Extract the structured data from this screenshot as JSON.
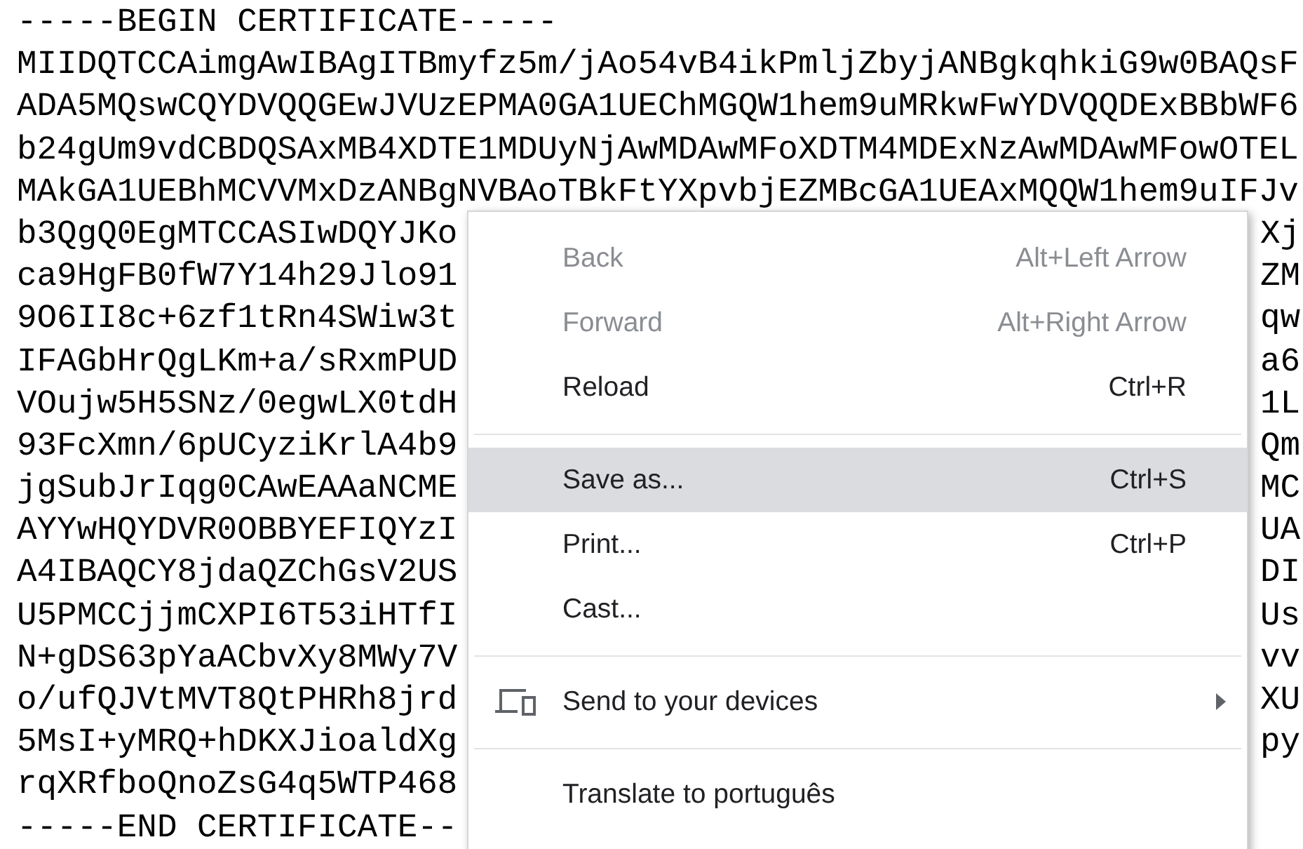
{
  "certificate_lines": [
    {
      "text": "-----BEGIN CERTIFICATE-----"
    },
    {
      "text": "MIIDQTCCAimgAwIBAgITBmyfz5m/jAo54vB4ikPmljZbyjANBgkqhkiG9w0BAQsF"
    },
    {
      "text": "ADA5MQswCQYDVQQGEwJVUzEPMA0GA1UEChMGQW1hem9uMRkwFwYDVQQDExBBbWF6"
    },
    {
      "text": "b24gUm9vdCBDQSAxMB4XDTE1MDUyNjAwMDAwMFoXDTM4MDExNzAwMDAwMFowOTEL"
    },
    {
      "text": "MAkGA1UEBhMCVVMxDzANBgNVBAoTBkFtYXpvbjEZMBcGA1UEAxMQQW1hem9uIFJv"
    },
    {
      "left": "b3QgQ0EgMTCCASIwDQYJKo",
      "right": "Xj"
    },
    {
      "left": "ca9HgFB0fW7Y14h29Jlo91",
      "right": "ZM"
    },
    {
      "left": "9O6II8c+6zf1tRn4SWiw3t",
      "right": "qw"
    },
    {
      "left": "IFAGbHrQgLKm+a/sRxmPUD",
      "right": "a6"
    },
    {
      "left": "VOujw5H5SNz/0egwLX0tdH",
      "right": "1L"
    },
    {
      "left": "93FcXmn/6pUCyziKrlA4b9",
      "right": "Qm"
    },
    {
      "left": "jgSubJrIqg0CAwEAAaNCME",
      "right": "MC"
    },
    {
      "left": "AYYwHQYDVR0OBBYEFIQYzI",
      "right": "UA"
    },
    {
      "left": "A4IBAQCY8jdaQZChGsV2US",
      "right": "DI"
    },
    {
      "left": "U5PMCCjjmCXPI6T53iHTfI",
      "right": "Us"
    },
    {
      "left": "N+gDS63pYaACbvXy8MWy7V",
      "right": "vv"
    },
    {
      "left": "o/ufQJVtMVT8QtPHRh8jrd",
      "right": "XU"
    },
    {
      "left": "5MsI+yMRQ+hDKXJioaldXg",
      "right": "py"
    },
    {
      "left": "rqXRfboQnoZsG4q5WTP468"
    },
    {
      "left": "-----END CERTIFICATE--"
    }
  ],
  "context_menu": {
    "items": [
      {
        "kind": "item",
        "label": "Back",
        "shortcut": "Alt+Left Arrow",
        "disabled": true,
        "selected": false
      },
      {
        "kind": "item",
        "label": "Forward",
        "shortcut": "Alt+Right Arrow",
        "disabled": true,
        "selected": false
      },
      {
        "kind": "item",
        "label": "Reload",
        "shortcut": "Ctrl+R",
        "disabled": false,
        "selected": false
      },
      {
        "kind": "separator"
      },
      {
        "kind": "item",
        "label": "Save as...",
        "shortcut": "Ctrl+S",
        "disabled": false,
        "selected": true
      },
      {
        "kind": "item",
        "label": "Print...",
        "shortcut": "Ctrl+P",
        "disabled": false,
        "selected": false
      },
      {
        "kind": "item",
        "label": "Cast...",
        "disabled": false,
        "selected": false
      },
      {
        "kind": "separator"
      },
      {
        "kind": "submenu",
        "label": "Send to your devices",
        "disabled": false,
        "selected": false
      },
      {
        "kind": "separator"
      },
      {
        "kind": "item",
        "label": "Translate to português",
        "disabled": false,
        "selected": false
      }
    ]
  }
}
